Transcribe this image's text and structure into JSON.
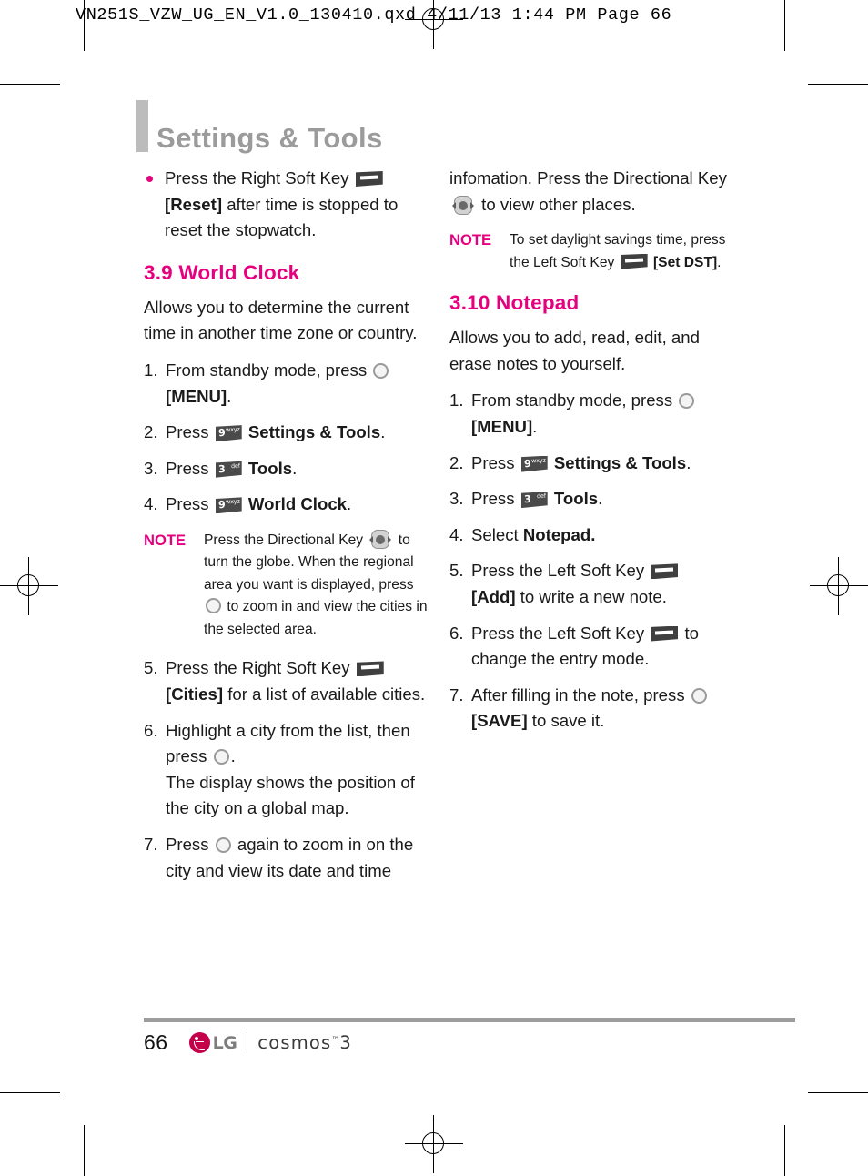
{
  "slug": {
    "text": "VN251S_VZW_UG_EN_V1.0_130410.qxd   4/11/13   1:44 PM   Page 66"
  },
  "colors": {
    "accent_pink": "#E6007E",
    "title_gray": "#9B9B9B",
    "rule_gray": "#9D9D9D",
    "lg_crimson": "#C4004B"
  },
  "header": {
    "title": "Settings & Tools"
  },
  "left_column": {
    "bullet": {
      "lead": "Press the Right Soft Key",
      "key_label": "[Reset]",
      "tail": " after time is stopped to reset the stopwatch."
    },
    "section": {
      "number_title": "3.9 World Clock",
      "intro": "Allows you to determine the current time in another time zone or country.",
      "steps": [
        {
          "num": "1.",
          "pre": "From standby mode, press ",
          "post": "",
          "bold_after": "[MENU]",
          "tail": "."
        },
        {
          "num": "2.",
          "pre": "Press ",
          "key": {
            "digit": "9",
            "letters": "wxyz"
          },
          "bold_after": "Settings & Tools",
          "tail": "."
        },
        {
          "num": "3.",
          "pre": "Press ",
          "key": {
            "digit": "3",
            "letters": "def"
          },
          "bold_after": "Tools",
          "tail": "."
        },
        {
          "num": "4.",
          "pre": "Press ",
          "key": {
            "digit": "9",
            "letters": "wxyz"
          },
          "bold_after": "World Clock",
          "tail": "."
        }
      ],
      "note": {
        "label": "NOTE",
        "part1": "Press the Directional Key ",
        "part2": " to turn the globe. When the regional area you want is displayed, press ",
        "part3": " to zoom in and view the cities in the selected area."
      },
      "steps2": [
        {
          "num": "5.",
          "pre": "Press the Right Soft Key ",
          "bold_after": "[Cities]",
          "tail": " for a list of available cities."
        },
        {
          "num": "6.",
          "pre": "Highlight a city from the list, then press ",
          "tail": ".",
          "extra": "The display shows the position of the city on a global map."
        },
        {
          "num": "7.",
          "pre": "Press ",
          "tail": " again to zoom in on the city and view its date and time"
        }
      ]
    }
  },
  "right_column": {
    "continued": {
      "part1": "infomation. Press the Directional Key ",
      "part2": " to view other places."
    },
    "note": {
      "label": "NOTE",
      "part1": "To set daylight savings time, press the Left Soft Key ",
      "part2": " ",
      "bold_after": "[Set DST]",
      "tail": "."
    },
    "section": {
      "number_title": "3.10 Notepad",
      "intro": "Allows you to add, read, edit, and erase notes to yourself.",
      "steps": [
        {
          "num": "1.",
          "pre": "From standby mode, press ",
          "bold_after": "[MENU]",
          "tail": "."
        },
        {
          "num": "2.",
          "pre": "Press ",
          "key": {
            "digit": "9",
            "letters": "wxyz"
          },
          "bold_after": "Settings & Tools",
          "tail": "."
        },
        {
          "num": "3.",
          "pre": "Press ",
          "key": {
            "digit": "3",
            "letters": "def"
          },
          "bold_after": "Tools",
          "tail": "."
        },
        {
          "num": "4.",
          "pre": "Select ",
          "bold_after": "Notepad.",
          "tail": ""
        },
        {
          "num": "5.",
          "pre": "Press the Left Soft Key ",
          "bold_after": "[Add]",
          "tail": " to write a new note."
        },
        {
          "num": "6.",
          "pre": "Press the Left Soft Key ",
          "tail": " to change the entry mode."
        },
        {
          "num": "7.",
          "pre": "After filling in the note, press ",
          "bold_after": "[SAVE]",
          "tail": " to save it."
        }
      ]
    }
  },
  "footer": {
    "page_number": "66",
    "brand": "LG",
    "product": "cosmos",
    "product_tm": "™",
    "product_num": "3"
  }
}
